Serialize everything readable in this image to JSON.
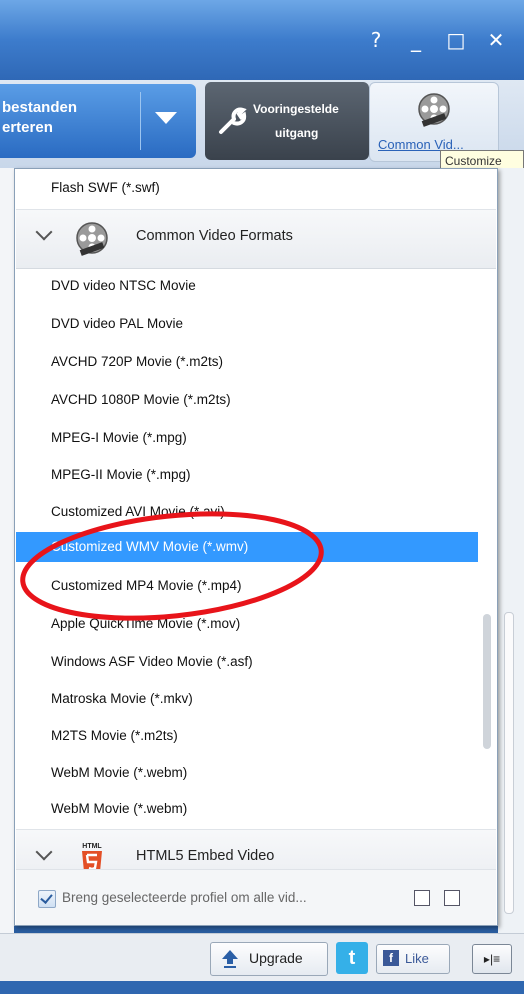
{
  "window": {
    "controls": {
      "help": "?",
      "minimize": "_",
      "maximize": "□",
      "close": "✕"
    }
  },
  "toolbar": {
    "convert_line1": "bestanden",
    "convert_line2": "erteren",
    "preset_line1": "Vooringestelde",
    "preset_line2": "uitgang",
    "common_video_label": "Common Vid...",
    "tooltip": "Customize"
  },
  "dropdown": {
    "top_item": "Flash SWF (*.swf)",
    "group_common": "Common Video Formats",
    "items": [
      "DVD video NTSC Movie",
      "DVD video PAL Movie",
      "AVCHD 720P Movie (*.m2ts)",
      "AVCHD 1080P Movie (*.m2ts)",
      "MPEG-I Movie (*.mpg)",
      "MPEG-II Movie (*.mpg)",
      "Customized AVI Movie (*.avi)",
      "Customized WMV Movie (*.wmv)",
      "Customized MP4 Movie (*.mp4)",
      "Apple QuickTime Movie (*.mov)",
      "Windows ASF Video Movie (*.asf)",
      "Matroska Movie (*.mkv)",
      "M2TS Movie (*.m2ts)",
      "WebM Movie (*.webm)",
      "WebM Movie (*.webm)"
    ],
    "selected_item": "Customized WMV Movie (*.wmv)",
    "group_html5": "HTML5 Embed Video",
    "html5_icon_text": "HTML",
    "apply_all_label": "Breng geselecteerde profiel om alle vid..."
  },
  "statusbar": {
    "upgrade": "Upgrade",
    "twitter": "t",
    "facebook": "f",
    "like": "Like",
    "panel_toggle": "▸|≡"
  },
  "colors": {
    "selection": "#3399ff",
    "annotation": "#e8141a",
    "title_bar": "#3d7ccc"
  }
}
